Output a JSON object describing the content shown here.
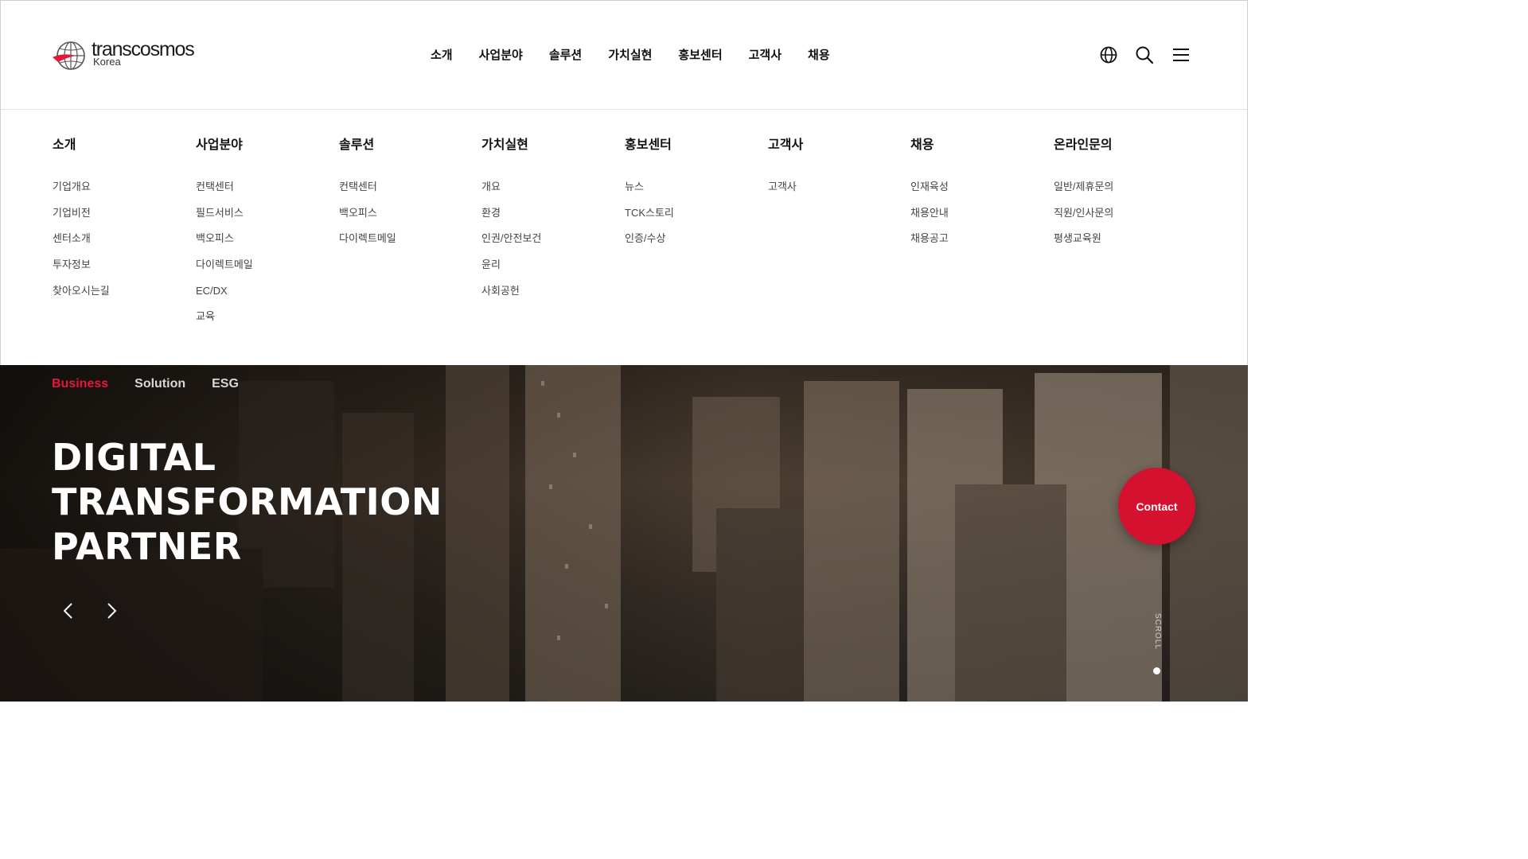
{
  "brand": {
    "name": "transcosmos",
    "sub": "Korea",
    "accent_color": "#e4183a"
  },
  "header": {
    "nav": [
      "소개",
      "사업분야",
      "솔루션",
      "가치실현",
      "홍보센터",
      "고객사",
      "채용"
    ],
    "icons": [
      "globe-icon",
      "search-icon",
      "hamburger-menu-icon"
    ]
  },
  "mega_menu": [
    {
      "title": "소개",
      "links": [
        "기업개요",
        "기업비전",
        "센터소개",
        "투자정보",
        "찾아오시는길"
      ]
    },
    {
      "title": "사업분야",
      "links": [
        "컨택센터",
        "필드서비스",
        "백오피스",
        "다이렉트메일",
        "EC/DX",
        "교육"
      ]
    },
    {
      "title": "솔루션",
      "links": [
        "컨택센터",
        "백오피스",
        "다이렉트메일"
      ]
    },
    {
      "title": "가치실현",
      "links": [
        "개요",
        "환경",
        "인권/안전보건",
        "윤리",
        "사회공헌"
      ]
    },
    {
      "title": "홍보센터",
      "links": [
        "뉴스",
        "TCK스토리",
        "인증/수상"
      ]
    },
    {
      "title": "고객사",
      "links": [
        "고객사"
      ]
    },
    {
      "title": "채용",
      "links": [
        "인재육성",
        "채용안내",
        "채용공고"
      ]
    },
    {
      "title": "온라인문의",
      "links": [
        "일반/제휴문의",
        "직원/인사문의",
        "평생교육원"
      ]
    }
  ],
  "hero": {
    "tabs": [
      "Business",
      "Solution",
      "ESG"
    ],
    "active_tab": "Business",
    "title_lines": [
      "DIGITAL",
      "TRANSFORMATION",
      "PARTNER"
    ],
    "prev_icon": "chevron-left-icon",
    "next_icon": "chevron-right-icon",
    "contact_label": "Contact",
    "contact_color": "#d4112f",
    "scroll_label": "SCROLL"
  }
}
